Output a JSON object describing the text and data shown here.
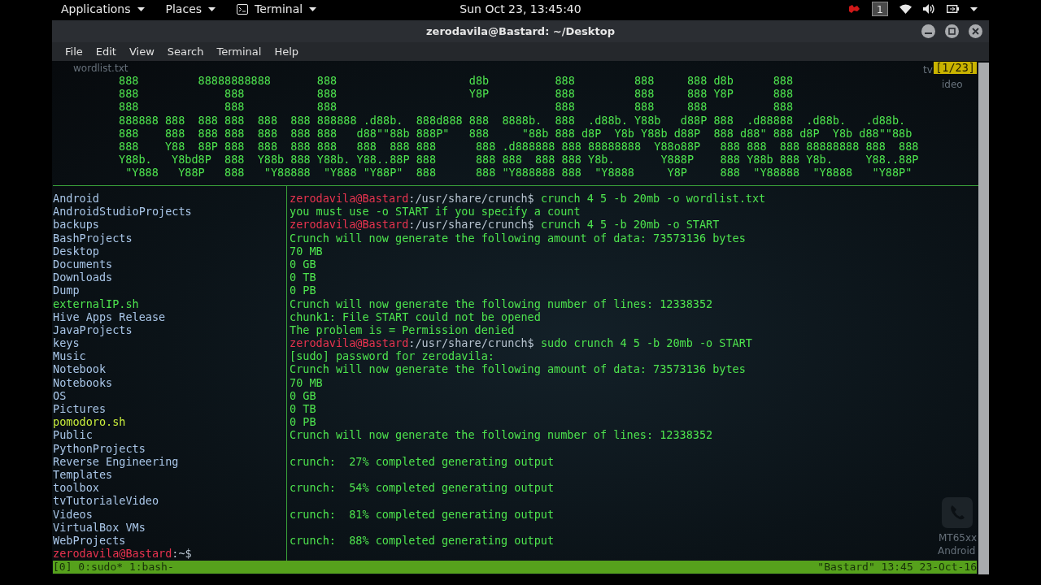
{
  "top_panel": {
    "menus": [
      {
        "label": "Applications",
        "kind": "menu"
      },
      {
        "label": "Places",
        "kind": "menu"
      },
      {
        "label": "Terminal",
        "kind": "app"
      }
    ],
    "clock": "Sun Oct 23, 13:45:40",
    "workspace": "1"
  },
  "window": {
    "title": "zerodavila@Bastard: ~/Desktop",
    "menu": [
      "File",
      "Edit",
      "View",
      "Search",
      "Terminal",
      "Help"
    ]
  },
  "desktop_behind": {
    "top_left": "wordlist.txt",
    "top_right": [
      "tv",
      "ideo"
    ],
    "bottom_right": [
      "MT65xx",
      "Android"
    ]
  },
  "top_pane": {
    "position": "[1/23]",
    "ascii_art": [
      "888         88888888888       888                    d8b          888         888     888 d8b      888",
      "888             888           888                    Y8P          888         888     888 Y8P      888",
      "888             888           888                                 888         888     888          888",
      "888888 888  888 888  888  888 888888 .d88b.  888d888 888  8888b.  888  .d88b. Y88b   d88P 888  .d88888  .d88b.   .d88b.",
      "888    888  888 888  888  888 888   d88\"\"88b 888P\"   888     \"88b 888 d8P  Y8b Y88b d88P  888 d88\" 888 d8P  Y8b d88\"\"88b",
      "888    Y88  88P 888  888  888 888   888  888 888      888 .d888888 888 88888888  Y88o88P   888 888  888 88888888 888  888",
      "Y88b.   Y8bd8P  888  Y88b 888 Y88b. Y88..88P 888      888 888  888 888 Y8b.       Y888P    888 Y88b 888 Y8b.     Y88..88P",
      " \"Y888   Y88P   888   \"Y88888  \"Y888 \"Y88P\"  888      888 \"Y888888 888  \"Y8888     Y8P     888  \"Y88888  \"Y8888   \"Y88P\""
    ]
  },
  "files": [
    {
      "name": "Android",
      "color": "#a9c6e8"
    },
    {
      "name": "AndroidStudioProjects",
      "color": "#a9c6e8"
    },
    {
      "name": "backups",
      "color": "#a9c6e8"
    },
    {
      "name": "BashProjects",
      "color": "#a9c6e8"
    },
    {
      "name": "Desktop",
      "color": "#a9c6e8"
    },
    {
      "name": "Documents",
      "color": "#a9c6e8"
    },
    {
      "name": "Downloads",
      "color": "#a9c6e8"
    },
    {
      "name": "Dump",
      "color": "#a9c6e8"
    },
    {
      "name": "externalIP.sh",
      "color": "#4ee44e"
    },
    {
      "name": "Hive Apps Release",
      "color": "#a9c6e8"
    },
    {
      "name": "JavaProjects",
      "color": "#a9c6e8"
    },
    {
      "name": "keys",
      "color": "#a9c6e8"
    },
    {
      "name": "Music",
      "color": "#a9c6e8"
    },
    {
      "name": "Notebook",
      "color": "#a9c6e8"
    },
    {
      "name": "Notebooks",
      "color": "#a9c6e8"
    },
    {
      "name": "OS",
      "color": "#a9c6e8"
    },
    {
      "name": "Pictures",
      "color": "#a9c6e8"
    },
    {
      "name": "pomodoro.sh",
      "color": "#c8ec3c"
    },
    {
      "name": "Public",
      "color": "#a9c6e8"
    },
    {
      "name": "PythonProjects",
      "color": "#a9c6e8"
    },
    {
      "name": "Reverse Engineering",
      "color": "#a9c6e8"
    },
    {
      "name": "Templates",
      "color": "#a9c6e8"
    },
    {
      "name": "toolbox",
      "color": "#a9c6e8"
    },
    {
      "name": "tvTutorialeVideo",
      "color": "#a9c6e8"
    },
    {
      "name": "Videos",
      "color": "#a9c6e8"
    },
    {
      "name": "VirtualBox VMs",
      "color": "#a9c6e8"
    },
    {
      "name": "WebProjects",
      "color": "#a9c6e8"
    }
  ],
  "left_prompt": {
    "user": "zerodavila@Bastard",
    "path": ":~$"
  },
  "output": [
    {
      "kind": "prompt",
      "user": "zerodavila@Bastard",
      "path": ":/usr/share/crunch$",
      "command": "crunch 4 5 -b 20mb -o wordlist.txt"
    },
    {
      "kind": "text",
      "text": "you must use -o START if you specify a count"
    },
    {
      "kind": "prompt",
      "user": "zerodavila@Bastard",
      "path": ":/usr/share/crunch$",
      "command": "crunch 4 5 -b 20mb -o START"
    },
    {
      "kind": "text",
      "text": "Crunch will now generate the following amount of data: 73573136 bytes"
    },
    {
      "kind": "text",
      "text": "70 MB"
    },
    {
      "kind": "text",
      "text": "0 GB"
    },
    {
      "kind": "text",
      "text": "0 TB"
    },
    {
      "kind": "text",
      "text": "0 PB"
    },
    {
      "kind": "text",
      "text": "Crunch will now generate the following number of lines: 12338352"
    },
    {
      "kind": "text",
      "text": "chunk1: File START could not be opened"
    },
    {
      "kind": "text",
      "text": "The problem is = Permission denied"
    },
    {
      "kind": "prompt",
      "user": "zerodavila@Bastard",
      "path": ":/usr/share/crunch$",
      "command": "sudo crunch 4 5 -b 20mb -o START"
    },
    {
      "kind": "text",
      "text": "[sudo] password for zerodavila:"
    },
    {
      "kind": "text",
      "text": "Crunch will now generate the following amount of data: 73573136 bytes"
    },
    {
      "kind": "text",
      "text": "70 MB"
    },
    {
      "kind": "text",
      "text": "0 GB"
    },
    {
      "kind": "text",
      "text": "0 TB"
    },
    {
      "kind": "text",
      "text": "0 PB"
    },
    {
      "kind": "text",
      "text": "Crunch will now generate the following number of lines: 12338352"
    },
    {
      "kind": "blank"
    },
    {
      "kind": "text",
      "text": "crunch:  27% completed generating output"
    },
    {
      "kind": "blank"
    },
    {
      "kind": "text",
      "text": "crunch:  54% completed generating output"
    },
    {
      "kind": "blank"
    },
    {
      "kind": "text",
      "text": "crunch:  81% completed generating output"
    },
    {
      "kind": "blank"
    },
    {
      "kind": "text",
      "text": "crunch:  88% completed generating output"
    }
  ],
  "status_bar": {
    "left": "[0] 0:sudo* 1:bash-",
    "right": "\"Bastard\" 13:45 23-Oct-16"
  }
}
